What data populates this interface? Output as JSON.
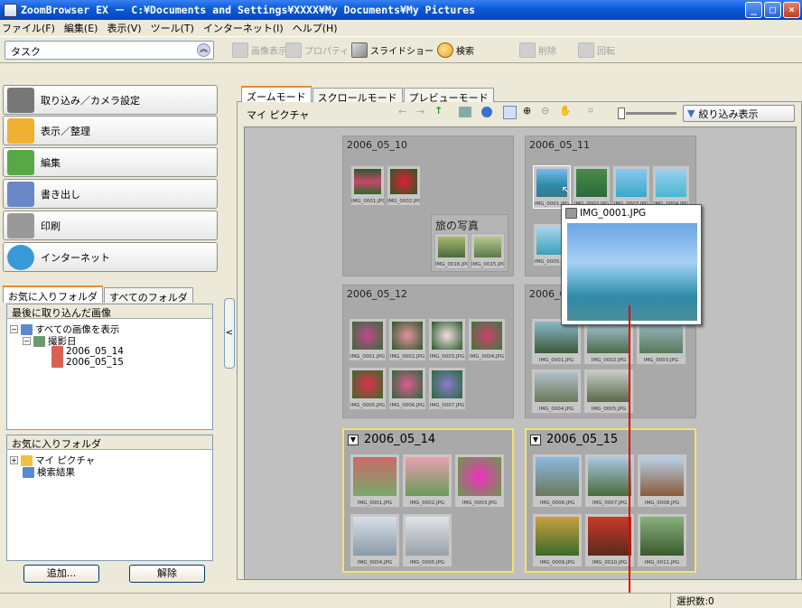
{
  "window": {
    "title": "ZoomBrowser EX － C:¥Documents and Settings¥XXXX¥My Documents¥My Pictures"
  },
  "menu": [
    "ファイル(F)",
    "編集(E)",
    "表示(V)",
    "ツール(T)",
    "インターネット(I)",
    "ヘルプ(H)"
  ],
  "task_dropdown": {
    "label": "タスク"
  },
  "toolbar": {
    "view_image": "画像表示",
    "properties": "プロパティ",
    "slideshow": "スライドショー",
    "search": "検索",
    "delete": "削除",
    "rotate": "回転"
  },
  "tasks": [
    {
      "label": "取り込み／カメラ設定",
      "icon": "camera-icon",
      "color": "#777"
    },
    {
      "label": "表示／整理",
      "icon": "folder-icon",
      "color": "#f0b030"
    },
    {
      "label": "編集",
      "icon": "edit-icon",
      "color": "#58a848"
    },
    {
      "label": "書き出し",
      "icon": "export-icon",
      "color": "#6888c8"
    },
    {
      "label": "印刷",
      "icon": "printer-icon",
      "color": "#999"
    },
    {
      "label": "インターネット",
      "icon": "globe-icon",
      "color": "#3a9ad8"
    }
  ],
  "folder_tabs": {
    "favorites": "お気に入りフォルダ",
    "all": "すべてのフォルダ"
  },
  "recent_box": {
    "header": "最後に取り込んだ画像",
    "show_all": "すべての画像を表示",
    "shot_date": "撮影日",
    "dates": [
      "2006_05_14",
      "2006_05_15"
    ]
  },
  "fav_box": {
    "header": "お気に入りフォルダ",
    "my_pictures": "マイ ピクチャ",
    "search_results": "検索結果"
  },
  "buttons": {
    "add": "追加...",
    "remove": "解除"
  },
  "view_tabs": [
    "ズームモード",
    "スクロールモード",
    "プレビューモード"
  ],
  "nav": {
    "location": "マイ ピクチャ",
    "filter": "絞り込み表示"
  },
  "groups": {
    "g1": {
      "title": "2006_05_10",
      "caps": [
        "IMG_0001.JPG",
        "IMG_0002.JPG"
      ]
    },
    "sub": {
      "title": "旅の写真",
      "caps": [
        "IMG_0016.JPG",
        "IMG_0015.JPG"
      ]
    },
    "g2": {
      "title": "2006_05_11",
      "caps": [
        "IMG_0001.JPG",
        "IMG_0002.JPG",
        "IMG_0003.JPG",
        "IMG_0004.JPG",
        "IMG_0005.JPG"
      ]
    },
    "g3": {
      "title": "2006_05_12",
      "caps": [
        "IMG_0001.JPG",
        "IMG_0002.JPG",
        "IMG_0003.JPG",
        "IMG_0004.JPG",
        "IMG_0005.JPG",
        "IMG_0006.JPG",
        "IMG_0007.JPG"
      ]
    },
    "g4": {
      "title": "2006_0",
      "caps": [
        "IMG_0001.JPG",
        "IMG_0002.JPG",
        "IMG_0003.JPG",
        "IMG_0004.JPG",
        "IMG_0005.JPG"
      ]
    },
    "g5": {
      "title": "2006_05_14",
      "caps": [
        "IMG_0001.JPG",
        "IMG_0002.JPG",
        "IMG_0003.JPG",
        "IMG_0004.JPG",
        "IMG_0005.JPG"
      ]
    },
    "g6": {
      "title": "2006_05_15",
      "caps": [
        "IMG_0006.JPG",
        "IMG_0007.JPG",
        "IMG_0008.JPG",
        "IMG_0009.JPG",
        "IMG_0010.JPG",
        "IMG_0011.JPG"
      ]
    }
  },
  "popup": {
    "filename": "IMG_0001.JPG"
  },
  "status": {
    "selected": "選択数:0"
  }
}
